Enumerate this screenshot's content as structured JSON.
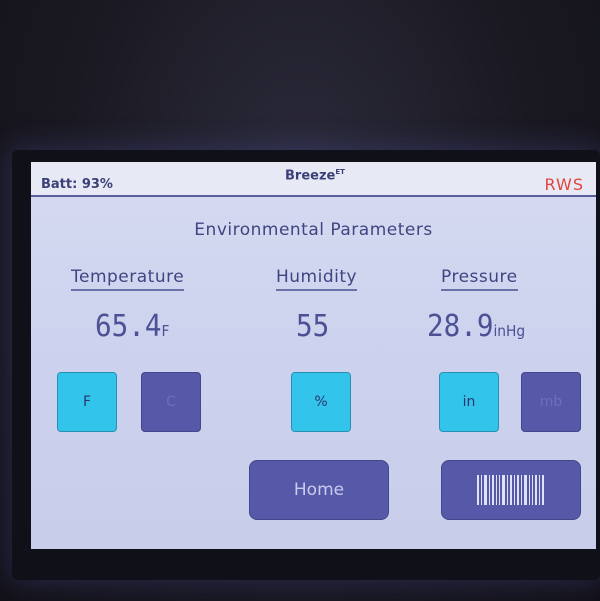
{
  "status_bar": {
    "battery": "Batt: 93%",
    "brand": "Breeze",
    "brand_sup": "ET",
    "rws": "RWS"
  },
  "screen": {
    "title": "Environmental Parameters"
  },
  "columns": {
    "temperature": {
      "label": "Temperature",
      "value": "65.4",
      "unit": "F"
    },
    "humidity": {
      "label": "Humidity",
      "value": "55",
      "unit": ""
    },
    "pressure": {
      "label": "Pressure",
      "value": "28.9",
      "unit": "inHg"
    }
  },
  "buttons": {
    "temp_f": "F",
    "temp_c": "C",
    "humidity_pct": "%",
    "pressure_in": "in",
    "pressure_mb": "mb",
    "home": "Home"
  },
  "icons": {
    "barcode": "barcode-icon"
  },
  "colors": {
    "active_button": "#33c4ec",
    "inactive_button": "#5658a8",
    "rws_label": "#e0453d"
  }
}
